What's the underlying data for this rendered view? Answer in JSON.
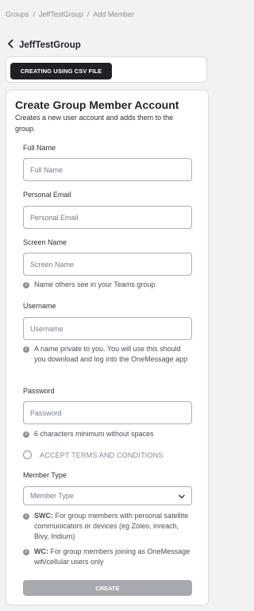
{
  "breadcrumb": {
    "items": [
      "Groups",
      "JeffTestGroup",
      "Add Member"
    ],
    "separator": "/"
  },
  "header": {
    "back_icon": "chevron-left-icon",
    "title": "JeffTestGroup"
  },
  "csv_button": {
    "label": "CREATING USING CSV FILE"
  },
  "form": {
    "title": "Create Group Member Account",
    "subtitle": "Creates a new user account and adds them to the group.",
    "full_name": {
      "label": "Full Name",
      "placeholder": "Full Name",
      "value": ""
    },
    "personal_email": {
      "label": "Personal Email",
      "placeholder": "Personal Email",
      "value": ""
    },
    "screen_name": {
      "label": "Screen Name",
      "placeholder": "Screen Name",
      "value": "",
      "hint": "Name others see in your Teams group"
    },
    "username": {
      "label": "Username",
      "placeholder": "Username",
      "value": "",
      "hint": "A name private to you. You will use this should you download and log into the OneMessage app"
    },
    "password": {
      "label": "Password",
      "placeholder": "Password",
      "value": "",
      "hint": "6 characters minimum without spaces"
    },
    "terms": {
      "label": "ACCEPT TERMS AND CONDITIONS",
      "checked": false
    },
    "member_type": {
      "label": "Member Type",
      "selected": "Member Type",
      "hints": [
        {
          "strong": "SWC:",
          "text": " For group members with personal satellite communicators or devices (eg Zoleo, inreach, Bivy, Iridium)"
        },
        {
          "strong": "WC:",
          "text": " For group members joining as OneMessage wifi/cellular users only"
        }
      ]
    },
    "create_button": {
      "label": "CREATE"
    }
  },
  "colors": {
    "page_bg": "#f2f2f3",
    "card_border": "#d9dbde",
    "dark_button": "#1f2126",
    "disabled_button": "#a6a9ad",
    "placeholder": "#6f7f91",
    "info_icon": "#8d939b"
  }
}
